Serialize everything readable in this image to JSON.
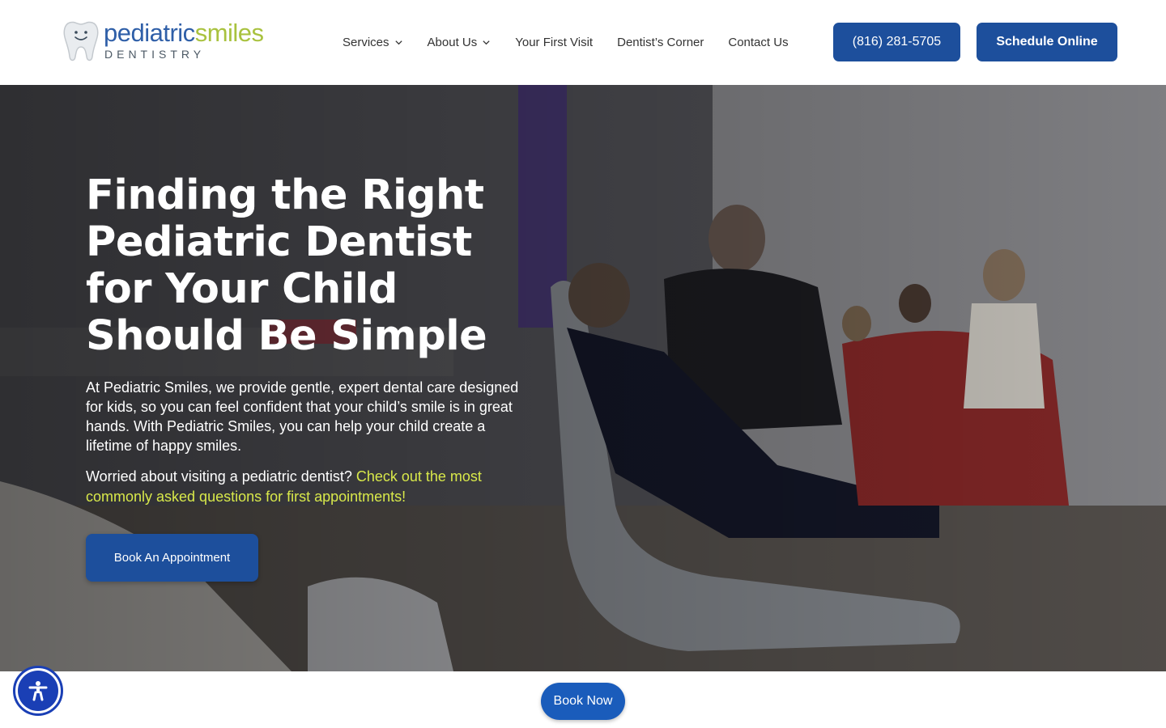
{
  "logo": {
    "word_part1": "pediatric",
    "word_part2": "smiles",
    "subtitle": "DENTISTRY",
    "icon": "tooth-icon"
  },
  "nav": {
    "items": [
      {
        "label": "Services",
        "has_dropdown": true
      },
      {
        "label": "About Us",
        "has_dropdown": true
      },
      {
        "label": "Your First Visit",
        "has_dropdown": false
      },
      {
        "label": "Dentist’s Corner",
        "has_dropdown": false
      },
      {
        "label": "Contact Us",
        "has_dropdown": false
      }
    ],
    "dropdown_icon": "chevron-down-icon"
  },
  "header_buttons": {
    "phone": "(816) 281-5705",
    "schedule": "Schedule Online"
  },
  "hero": {
    "title": "Finding the Right Pediatric Dentist for Your Child Should Be Simple",
    "body": "At Pediatric Smiles, we provide gentle, expert dental care designed for kids, so you can feel confident that your child’s smile is in great hands. With Pediatric Smiles, you can help your child create a lifetime of happy smiles.",
    "question": "Worried about visiting a pediatric dentist?",
    "link": "Check out the most commonly asked questions for first appointments!",
    "cta": "Book An Appointment"
  },
  "floating": {
    "book_now": "Book Now",
    "accessibility_icon": "accessibility-icon"
  },
  "colors": {
    "brand_blue": "#1d4f9c",
    "logo_blue": "#2f5fa8",
    "logo_green": "#a9c23f",
    "link_yellow": "#d8e84a",
    "book_now_blue": "#1a5cbb",
    "a11y_blue": "#1a3fb5"
  }
}
